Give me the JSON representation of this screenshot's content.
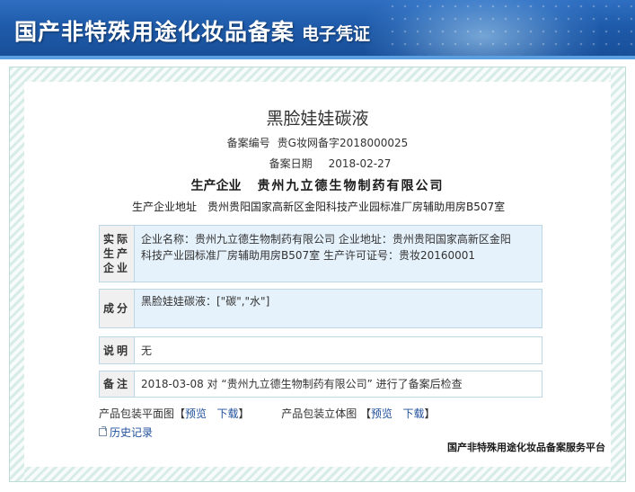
{
  "banner": {
    "title": "国产非特殊用途化妆品备案",
    "subtitle": "电子凭证"
  },
  "product": {
    "name": "黑脸娃娃碳液"
  },
  "filing": {
    "number_label": "备案编号",
    "number_value": "贵G妆网备字2018000025",
    "date_label": "备案日期",
    "date_value": "2018-02-27"
  },
  "manufacturer": {
    "label": "生产企业",
    "name": "贵州九立德生物制药有限公司",
    "address_label": "生产企业地址",
    "address_value": "贵州贵阳国家高新区金阳科技产业园标准厂房辅助用房B507室"
  },
  "actual_maker": {
    "label_line1": "实际",
    "label_line2": "生产",
    "label_line3": "企业",
    "line1": "企业名称：贵州九立德生物制药有限公司      企业地址：贵州贵阳国家高新区金阳",
    "line2": "科技产业园标准厂房辅助用房B507室      生产许可证号：贵妆20160001"
  },
  "ingredients": {
    "label": "成分",
    "value": "黑脸娃娃碳液：[\"碳\",\"水\"]"
  },
  "description": {
    "label": "说明",
    "value": "无"
  },
  "remark": {
    "label": "备注",
    "value": "2018-03-08 对 “贵州九立德生物制药有限公司” 进行了备案后检查"
  },
  "packaging": {
    "flat_label": "产品包装平面图",
    "solid_label": "产品包装立体图",
    "preview_link": "预览",
    "download_link": "下载",
    "bracket_open": "【",
    "bracket_close": "】"
  },
  "history": {
    "label": "历史记录"
  },
  "footer": {
    "platform": "国产非特殊用途化妆品备案服务平台"
  }
}
